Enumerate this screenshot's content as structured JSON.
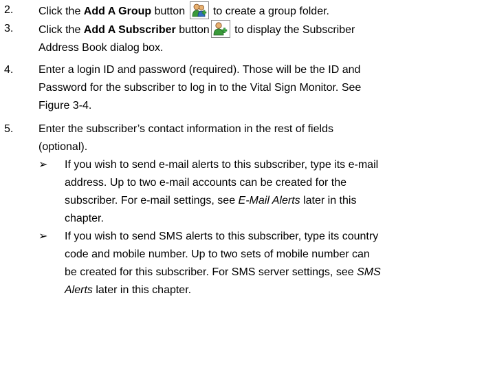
{
  "steps": [
    {
      "number": "2.",
      "pre": "Click the ",
      "bold": "Add A Group",
      "mid": " button ",
      "icon": "add-group-icon",
      "post": " to create a group folder."
    },
    {
      "number": "3.",
      "pre": "Click the ",
      "bold": "Add A Subscriber",
      "mid": " button",
      "icon": "add-subscriber-icon",
      "post": " to display the Subscriber",
      "line2": "Address Book dialog box."
    },
    {
      "number": "4.",
      "line1": "Enter a login ID and password (required). Those will be the ID and",
      "line2": "Password for the subscriber to log in to the Vital Sign Monitor. See",
      "line3": "Figure 3-4."
    },
    {
      "number": "5.",
      "line1": "Enter the subscriber’s contact information in the rest of fields",
      "line2": "(optional)."
    }
  ],
  "bullets": [
    {
      "marker": "➢",
      "line1": "If you wish to send e-mail alerts to this subscriber, type its e-mail",
      "line2": "address. Up to two e-mail accounts can be created for the",
      "line3_pre": "subscriber. For e-mail settings, see ",
      "line3_italic": "E-Mail Alerts",
      "line3_post": " later in this",
      "line4": "chapter."
    },
    {
      "marker": "➢",
      "line1": "If you wish to send SMS alerts to this subscriber, type its country",
      "line2": "code and mobile number. Up to two sets of mobile number can",
      "line3_pre": "be created for this subscriber. For SMS server settings, see ",
      "line3_italic": "SMS",
      "line4_italic": "Alerts",
      "line4_post": " later in this chapter."
    }
  ],
  "colors": {
    "person_green": "#3a9a3a",
    "person_blue": "#2f6fc0",
    "person_skin": "#e8b070",
    "plus_green": "#3cb043"
  }
}
